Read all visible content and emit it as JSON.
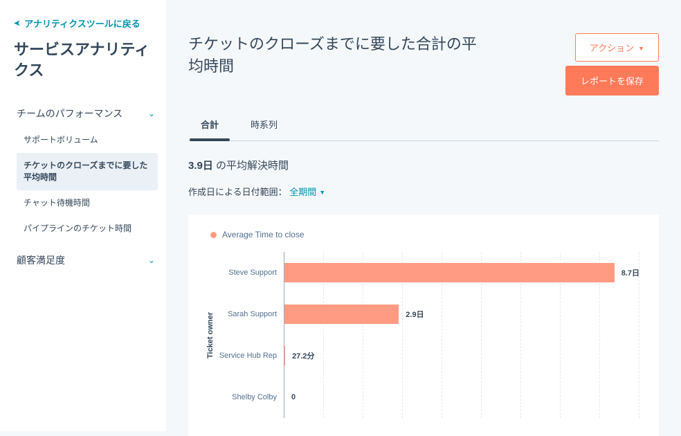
{
  "sidebar": {
    "back_label": "アナリティクスツールに戻る",
    "title": "サービスアナリティクス",
    "section1": {
      "label": "チームのパフォーマンス",
      "items": [
        "サポートボリューム",
        "チケットのクローズまでに要した平均時間",
        "チャット待機時間",
        "パイプラインのチケット時間"
      ]
    },
    "section2": {
      "label": "顧客満足度"
    }
  },
  "header": {
    "title": "チケットのクローズまでに要した合計の平均時間",
    "action_button": "アクション",
    "save_button": "レポートを保存"
  },
  "tabs": {
    "t0": "合計",
    "t1": "時系列"
  },
  "metric": {
    "value": "3.9日",
    "label": " の平均解決時間"
  },
  "filter": {
    "prefix": "作成日による日付範囲：",
    "value": "全期間"
  },
  "legend": {
    "series": "Average Time to close"
  },
  "axis": {
    "y_title": "Ticket owner"
  },
  "chart_data": {
    "type": "bar",
    "orientation": "horizontal",
    "title": "チケットのクローズまでに要した合計の平均時間",
    "xlabel": "Average Time to close",
    "ylabel": "Ticket owner",
    "categories": [
      "Steve Support",
      "Sarah Support",
      "Service Hub Rep",
      "Shelby Colby"
    ],
    "values_days": [
      8.7,
      2.9,
      0.0189,
      0
    ],
    "value_labels": [
      "8.7日",
      "2.9日",
      "27.2分",
      "0"
    ],
    "series": [
      {
        "name": "Average Time to close",
        "values": [
          8.7,
          2.9,
          0.0189,
          0
        ]
      }
    ],
    "xlim_days": [
      0,
      9
    ]
  }
}
